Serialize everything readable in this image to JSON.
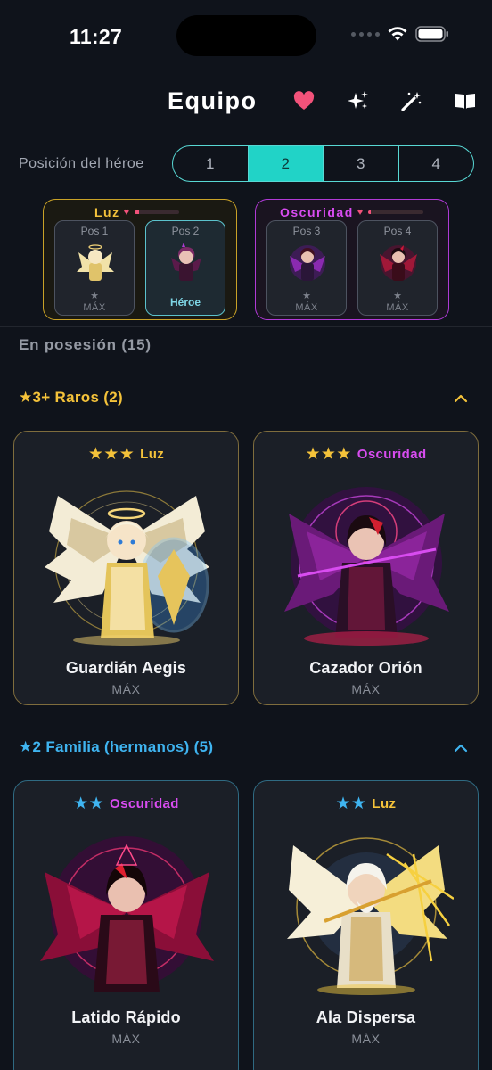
{
  "status": {
    "time": "11:27"
  },
  "header": {
    "title": "Equipo",
    "icons": [
      "heart-icon",
      "sparkles-icon",
      "magic-wand-icon",
      "book-icon"
    ]
  },
  "position": {
    "label": "Posición del héroe",
    "options": [
      "1",
      "2",
      "3",
      "4"
    ],
    "selected": "2"
  },
  "teams": [
    {
      "name": "Luz",
      "color": "#f2c13b",
      "affinity": 0.1,
      "slots": [
        {
          "label": "Pos 1",
          "star": "★",
          "sub": "MÁX"
        },
        {
          "label": "Pos 2",
          "sub": "Héroe"
        }
      ]
    },
    {
      "name": "Oscuridad",
      "color": "#d84cf0",
      "affinity": 0.05,
      "slots": [
        {
          "label": "Pos 3",
          "star": "★",
          "sub": "MÁX"
        },
        {
          "label": "Pos 4",
          "star": "★",
          "sub": "MÁX"
        }
      ]
    }
  ],
  "owned_label": "En posesión (15)",
  "sections": [
    {
      "title": "★3+ Raros (2)",
      "color": "#f4c23a",
      "cards": [
        {
          "stars": "★★★",
          "element": "Luz",
          "element_color": "#f4c23a",
          "name": "Guardián Aegis",
          "sub": "MÁX"
        },
        {
          "stars": "★★★",
          "element": "Oscuridad",
          "element_color": "#d84cf0",
          "name": "Cazador Orión",
          "sub": "MÁX"
        }
      ]
    },
    {
      "title": "★2 Familia (hermanos) (5)",
      "color": "#3fb4f0",
      "cards": [
        {
          "stars": "★★",
          "element": "Oscuridad",
          "element_color": "#d84cf0",
          "name": "Latido Rápido",
          "sub": "MÁX"
        },
        {
          "stars": "★★",
          "element": "Luz",
          "element_color": "#f4c23a",
          "name": "Ala Dispersa",
          "sub": "MÁX"
        }
      ]
    }
  ]
}
